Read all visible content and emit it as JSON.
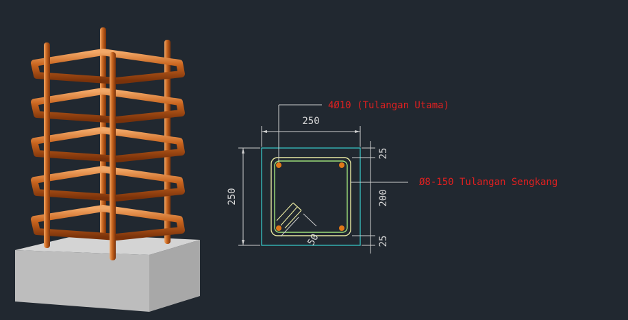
{
  "colors": {
    "background": "#212830",
    "rebar": "#c8641e",
    "rebar_highlight": "#f0a060",
    "rebar_shadow": "#8a3a0c",
    "concrete_top": "#d2d2d2",
    "concrete_side": "#b9b9b9",
    "section_outline": "#39d0d0",
    "stirrup_outer": "#e6e6a0",
    "stirrup_inner": "#9ee07a",
    "dimension": "#cfcfcf",
    "label_red": "#e02020",
    "main_bar": "#e07818"
  },
  "section": {
    "top_dim": "250",
    "left_dim": "250",
    "right_top_dim": "25",
    "right_mid_dim": "200",
    "right_bottom_dim": "25",
    "hook_dim": "50"
  },
  "labels": {
    "main_rebar": "4Ø10 (Tulangan Utama)",
    "stirrup": "Ø8-150 Tulangan Sengkang"
  }
}
